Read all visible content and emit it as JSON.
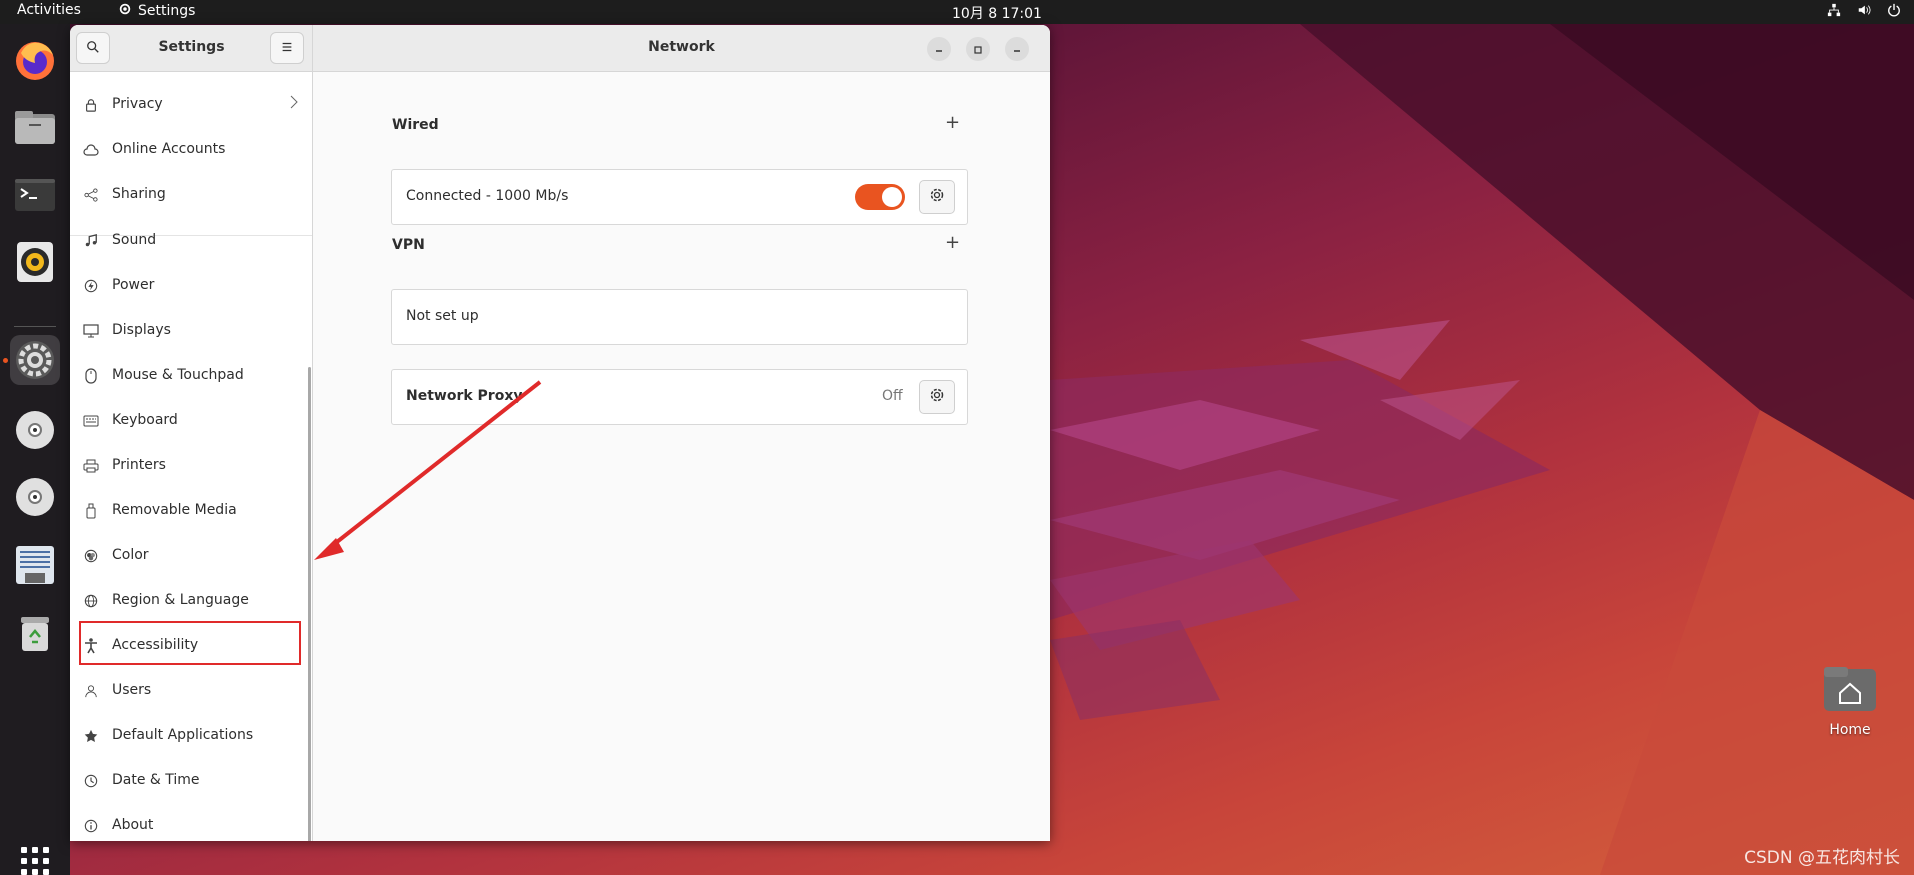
{
  "topbar": {
    "activities": "Activities",
    "app_name": "Settings",
    "clock": "10月 8  17:01"
  },
  "dock": {
    "items": [
      "firefox-icon",
      "files-icon",
      "terminal-icon",
      "rhythmbox-icon",
      "settings-icon",
      "disc-icon",
      "disc-icon",
      "text-editor-icon",
      "trash-icon",
      "show-apps-icon"
    ]
  },
  "window": {
    "sidebar_title": "Settings",
    "main_title": "Network"
  },
  "sidebar": {
    "items": [
      {
        "label": "Privacy",
        "icon": "lock-icon"
      },
      {
        "label": "Online Accounts",
        "icon": "cloud-icon"
      },
      {
        "label": "Sharing",
        "icon": "share-icon"
      },
      {
        "label": "Sound",
        "icon": "music-note-icon"
      },
      {
        "label": "Power",
        "icon": "power-icon"
      },
      {
        "label": "Displays",
        "icon": "display-icon"
      },
      {
        "label": "Mouse & Touchpad",
        "icon": "mouse-icon"
      },
      {
        "label": "Keyboard",
        "icon": "keyboard-icon"
      },
      {
        "label": "Printers",
        "icon": "printer-icon"
      },
      {
        "label": "Removable Media",
        "icon": "usb-icon"
      },
      {
        "label": "Color",
        "icon": "color-icon"
      },
      {
        "label": "Region & Language",
        "icon": "globe-icon"
      },
      {
        "label": "Accessibility",
        "icon": "accessibility-icon"
      },
      {
        "label": "Users",
        "icon": "users-icon"
      },
      {
        "label": "Default Applications",
        "icon": "star-icon"
      },
      {
        "label": "Date & Time",
        "icon": "clock-icon"
      },
      {
        "label": "About",
        "icon": "info-icon"
      }
    ]
  },
  "network": {
    "wired": {
      "title": "Wired",
      "status": "Connected - 1000 Mb/s",
      "enabled": true
    },
    "vpn": {
      "title": "VPN",
      "status": "Not set up"
    },
    "proxy": {
      "title": "Network Proxy",
      "status": "Off"
    }
  },
  "desktop": {
    "home_label": "Home"
  },
  "watermark": "CSDN @五花肉村长",
  "colors": {
    "accent": "#e95420",
    "annotation": "#e02a2a"
  }
}
